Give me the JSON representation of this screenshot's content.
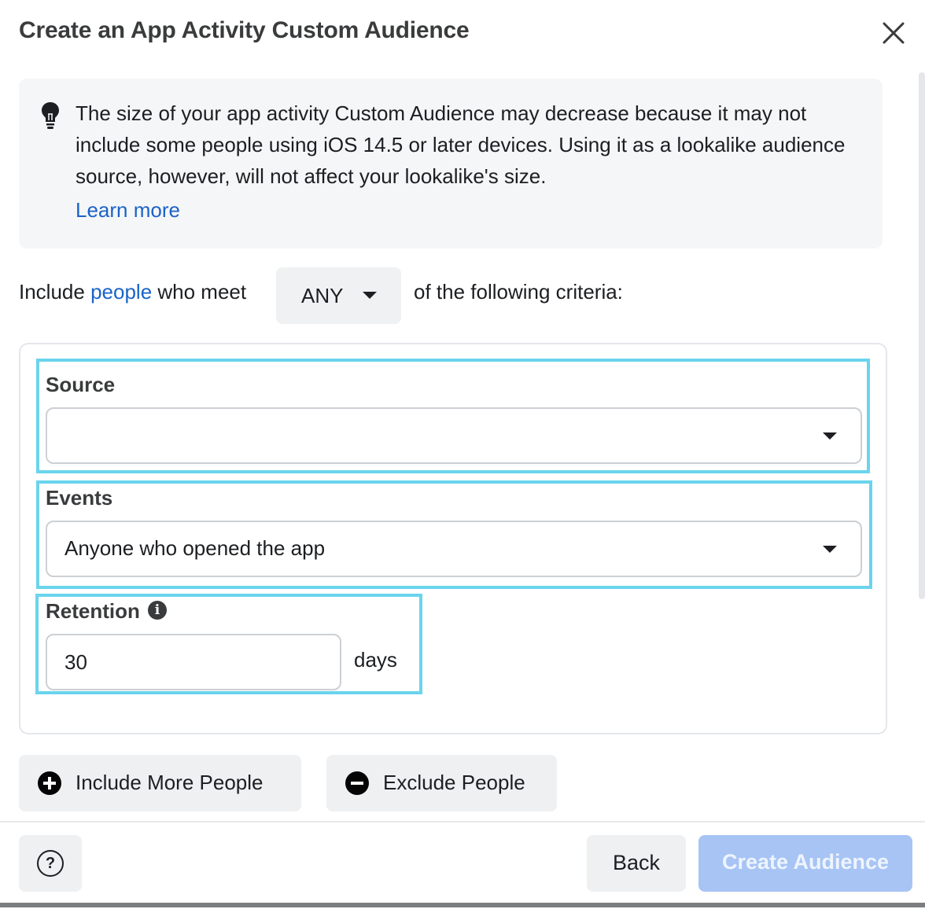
{
  "dialog": {
    "title": "Create an App Activity Custom Audience",
    "close_icon": "close-icon"
  },
  "notice": {
    "icon": "lightbulb-icon",
    "text": "The size of your app activity Custom Audience may decrease because it may not include some people using iOS 14.5 or later devices. Using it as a lookalike audience source, however, will not affect your lookalike's size.",
    "link": "Learn more"
  },
  "criteria": {
    "prefix": "Include ",
    "link": "people",
    "middle": " who meet",
    "match_value": "ANY",
    "suffix": "of the following criteria:"
  },
  "rule": {
    "source": {
      "label": "Source",
      "value": ""
    },
    "events": {
      "label": "Events",
      "value": "Anyone who opened the app"
    },
    "retention": {
      "label": "Retention",
      "value": "30",
      "unit": "days",
      "info_icon": "info-icon"
    }
  },
  "actions": {
    "include_more": "Include More People",
    "exclude": "Exclude People"
  },
  "footer": {
    "help_icon": "question-circle-icon",
    "back": "Back",
    "create": "Create Audience"
  },
  "colors": {
    "highlight": "#6ad4ed",
    "link": "#1a63c9",
    "create_disabled": "#a7c4f5"
  }
}
